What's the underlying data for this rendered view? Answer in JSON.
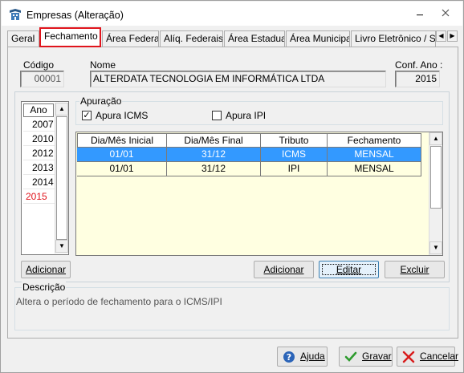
{
  "window": {
    "title": "Empresas (Alteração)"
  },
  "tabs": [
    {
      "label": "Geral"
    },
    {
      "label": "Fechamento",
      "active": true
    },
    {
      "label": "Área Federal"
    },
    {
      "label": "Alíq. Federais"
    },
    {
      "label": "Área Estadual"
    },
    {
      "label": "Área Municipal"
    },
    {
      "label": "Livro Eletrônico / SP"
    }
  ],
  "company": {
    "codigo_label": "Código",
    "codigo_value": "00001",
    "nome_label": "Nome",
    "nome_value": "ALTERDATA TECNOLOGIA EM INFORMÁTICA LTDA",
    "conf_ano_label": "Conf. Ano :",
    "conf_ano_value": "2015"
  },
  "years": {
    "header": "Ano",
    "items": [
      "2007",
      "2010",
      "2012",
      "2013",
      "2014",
      "2015"
    ],
    "selected": "2015",
    "add_label": "Adicionar"
  },
  "apuracao": {
    "title": "Apuração",
    "icms_label": "Apura ICMS",
    "icms_checked": true,
    "ipi_label": "Apura IPI",
    "ipi_checked": false
  },
  "grid": {
    "columns": [
      "Dia/Mês Inicial",
      "Dia/Mês Final",
      "Tributo",
      "Fechamento"
    ],
    "rows": [
      [
        "01/01",
        "31/12",
        "ICMS",
        "MENSAL"
      ],
      [
        "01/01",
        "31/12",
        "IPI",
        "MENSAL"
      ]
    ],
    "selected_row": 0
  },
  "grid_buttons": {
    "add": "Adicionar",
    "edit": "Editar",
    "delete": "Excluir"
  },
  "descricao": {
    "title": "Descrição",
    "text": "Altera o período de fechamento para o ICMS/IPI"
  },
  "footer": {
    "help": "Ajuda",
    "save": "Gravar",
    "cancel": "Cancelar"
  },
  "colors": {
    "selection": "#3399ff",
    "grid_bg": "#ffffe1",
    "highlight_red": "#e0141c",
    "accent_green": "#2e9b2e"
  }
}
